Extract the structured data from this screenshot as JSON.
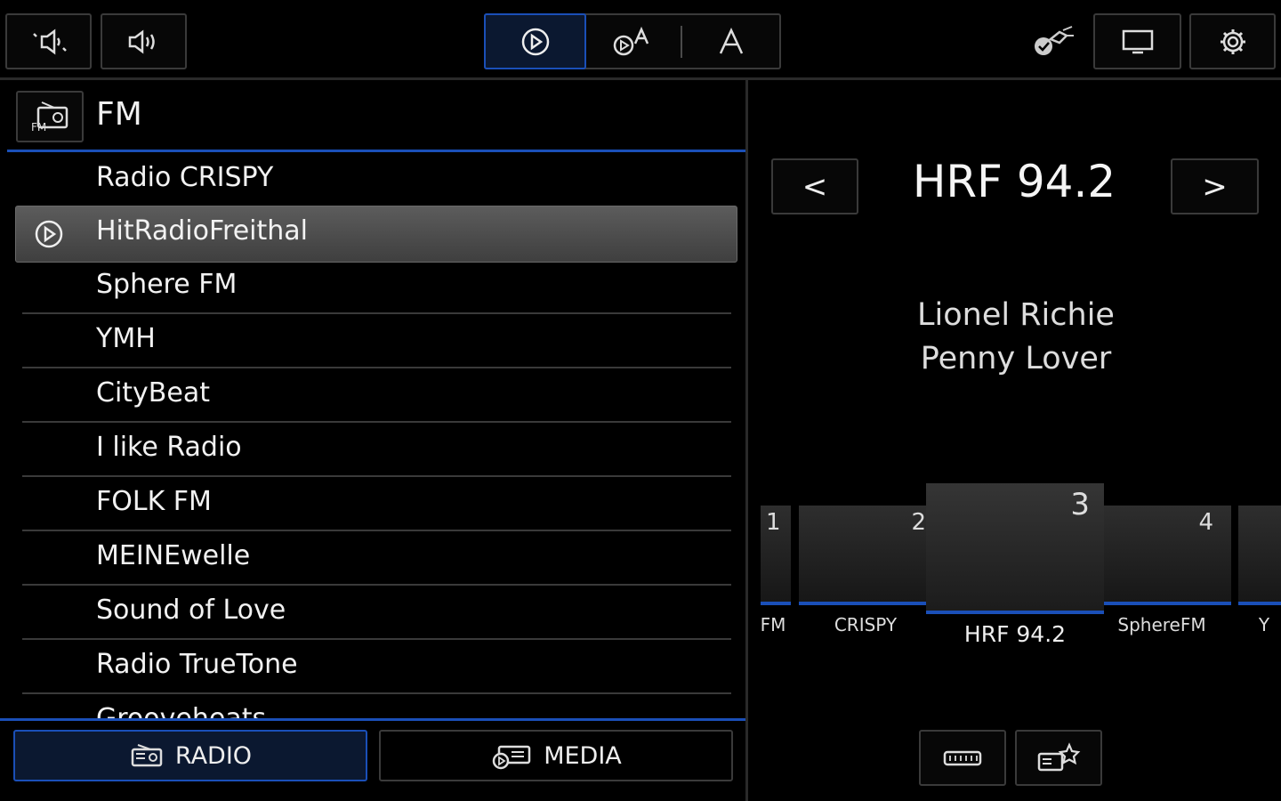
{
  "top_bar": {
    "volume_down_icon": "volume-down-icon",
    "volume_up_icon": "volume-up-icon",
    "source_tabs": [
      "play-icon",
      "play-text-icon",
      "text-icon"
    ],
    "right_icons": [
      "satellite-icon",
      "screen-icon",
      "gear-icon"
    ]
  },
  "band": {
    "label": "FM"
  },
  "station_list": {
    "items": [
      {
        "label": "Radio CRISPY",
        "playing": false
      },
      {
        "label": "HitRadioFreithal",
        "playing": true
      },
      {
        "label": "Sphere FM",
        "playing": false
      },
      {
        "label": "YMH",
        "playing": false
      },
      {
        "label": "CityBeat",
        "playing": false
      },
      {
        "label": "I like Radio",
        "playing": false
      },
      {
        "label": "FOLK FM",
        "playing": false
      },
      {
        "label": "MEINEwelle",
        "playing": false
      },
      {
        "label": "Sound of Love",
        "playing": false
      },
      {
        "label": "Radio TrueTone",
        "playing": false
      },
      {
        "label": "Grooveheats",
        "playing": false
      }
    ]
  },
  "bottom_tabs": {
    "radio_label": "RADIO",
    "media_label": "MEDIA"
  },
  "now_playing": {
    "prev_label": "<",
    "next_label": ">",
    "station": "HRF 94.2",
    "artist": "Lionel Richie",
    "title": "Penny Lover"
  },
  "presets": [
    {
      "number": "1",
      "label": "FM"
    },
    {
      "number": "2",
      "label": "CRISPY"
    },
    {
      "number": "3",
      "label": "HRF 94.2"
    },
    {
      "number": "4",
      "label": "SphereFM"
    },
    {
      "number": "",
      "label": "Y"
    }
  ],
  "colors": {
    "accent": "#1a4fb8",
    "background": "#000000",
    "selected_row": "#4f4f4f"
  }
}
